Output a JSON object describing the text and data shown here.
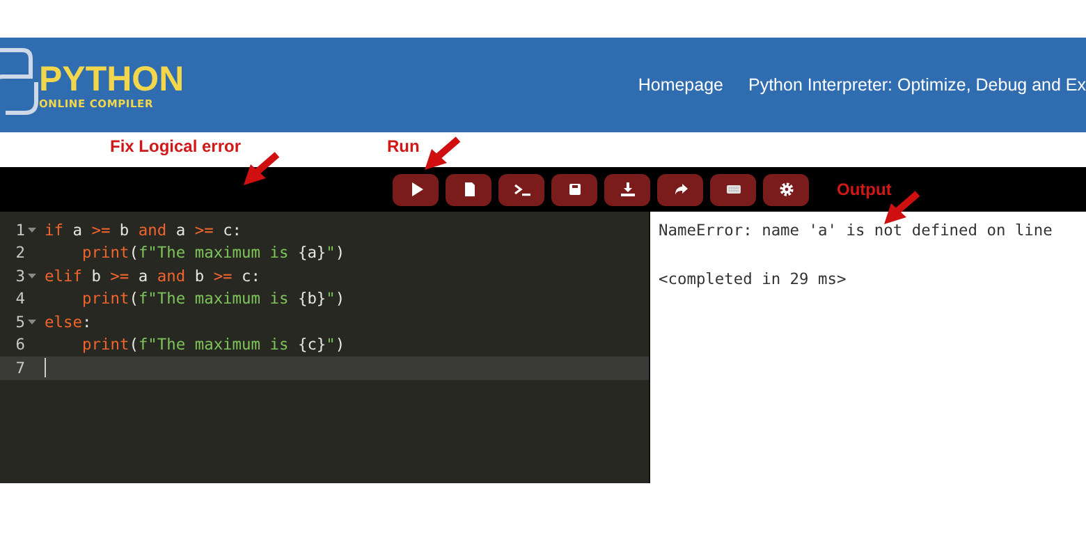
{
  "header": {
    "logo_title": "PYTHON",
    "logo_subtitle": "ONLINE COMPILER",
    "nav": [
      {
        "label": "Homepage"
      },
      {
        "label": "Python Interpreter: Optimize, Debug and Ex"
      }
    ]
  },
  "annotations": [
    {
      "text": "Fix Logical error"
    },
    {
      "text": "Run"
    },
    {
      "text": "Output"
    }
  ],
  "toolbar": [
    {
      "kind": "run"
    },
    {
      "kind": "new-file"
    },
    {
      "kind": "terminal"
    },
    {
      "kind": "save"
    },
    {
      "kind": "download"
    },
    {
      "kind": "share"
    },
    {
      "kind": "keyboard"
    },
    {
      "kind": "settings"
    }
  ],
  "editor": {
    "lines": [
      {
        "number": "1",
        "foldable": true,
        "current": false,
        "indented": false,
        "tokens": [
          {
            "kind": "keyword",
            "text": "if"
          },
          {
            "kind": "plain",
            "text": " a "
          },
          {
            "kind": "keyword",
            "text": ">="
          },
          {
            "kind": "plain",
            "text": " b "
          },
          {
            "kind": "keyword",
            "text": "and"
          },
          {
            "kind": "plain",
            "text": " a "
          },
          {
            "kind": "keyword",
            "text": ">="
          },
          {
            "kind": "plain",
            "text": " c:"
          }
        ]
      },
      {
        "number": "2",
        "foldable": false,
        "current": false,
        "indented": true,
        "tokens": [
          {
            "kind": "keyword",
            "text": "print"
          },
          {
            "kind": "plain",
            "text": "("
          },
          {
            "kind": "string",
            "text": "f\"The maximum is "
          },
          {
            "kind": "plain",
            "text": "{a}"
          },
          {
            "kind": "string",
            "text": "\""
          },
          {
            "kind": "plain",
            "text": ")"
          }
        ]
      },
      {
        "number": "3",
        "foldable": true,
        "current": false,
        "indented": false,
        "tokens": [
          {
            "kind": "keyword",
            "text": "elif"
          },
          {
            "kind": "plain",
            "text": " b "
          },
          {
            "kind": "keyword",
            "text": ">="
          },
          {
            "kind": "plain",
            "text": " a "
          },
          {
            "kind": "keyword",
            "text": "and"
          },
          {
            "kind": "plain",
            "text": " b "
          },
          {
            "kind": "keyword",
            "text": ">="
          },
          {
            "kind": "plain",
            "text": " c:"
          }
        ]
      },
      {
        "number": "4",
        "foldable": false,
        "current": false,
        "indented": true,
        "tokens": [
          {
            "kind": "keyword",
            "text": "print"
          },
          {
            "kind": "plain",
            "text": "("
          },
          {
            "kind": "string",
            "text": "f\"The maximum is "
          },
          {
            "kind": "plain",
            "text": "{b}"
          },
          {
            "kind": "string",
            "text": "\""
          },
          {
            "kind": "plain",
            "text": ")"
          }
        ]
      },
      {
        "number": "5",
        "foldable": true,
        "current": false,
        "indented": false,
        "tokens": [
          {
            "kind": "keyword",
            "text": "else"
          },
          {
            "kind": "plain",
            "text": ":"
          }
        ]
      },
      {
        "number": "6",
        "foldable": false,
        "current": false,
        "indented": true,
        "tokens": [
          {
            "kind": "keyword",
            "text": "print"
          },
          {
            "kind": "plain",
            "text": "("
          },
          {
            "kind": "string",
            "text": "f\"The maximum is "
          },
          {
            "kind": "plain",
            "text": "{c}"
          },
          {
            "kind": "string",
            "text": "\""
          },
          {
            "kind": "plain",
            "text": ")"
          }
        ]
      },
      {
        "number": "7",
        "foldable": false,
        "current": true,
        "indented": false
      }
    ]
  },
  "output": {
    "lines": [
      "NameError: name 'a' is not defined on line",
      "<completed in 29 ms>"
    ]
  }
}
